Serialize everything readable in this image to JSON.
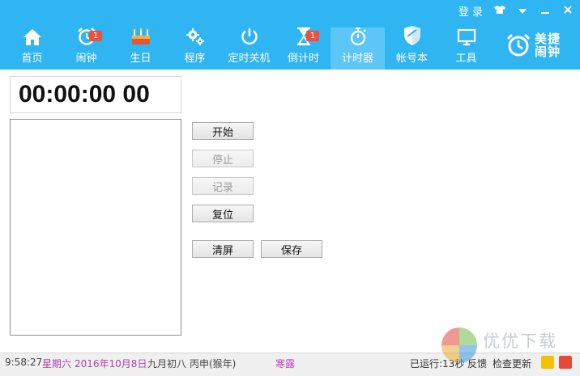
{
  "window": {
    "login_label": "登 录",
    "controls": {
      "skin_icon": "shirt-icon",
      "menu_icon": "chevron-down-icon",
      "minimize_icon": "minimize-icon",
      "close_icon": "close-icon"
    }
  },
  "nav": {
    "items": [
      {
        "label": "首页",
        "icon": "home-icon"
      },
      {
        "label": "闹钟",
        "icon": "alarm-clock-icon",
        "badge": "1"
      },
      {
        "label": "生日",
        "icon": "birthday-cake-icon"
      },
      {
        "label": "程序",
        "icon": "gear-icon"
      },
      {
        "label": "定时关机",
        "icon": "power-icon"
      },
      {
        "label": "倒计时",
        "icon": "hourglass-icon",
        "badge": "1"
      },
      {
        "label": "计时器",
        "icon": "stopwatch-icon",
        "active": true
      },
      {
        "label": "帐号本",
        "icon": "shield-icon"
      },
      {
        "label": "工具",
        "icon": "monitor-icon"
      }
    ],
    "brand_line1": "美捷",
    "brand_line2": "闹钟"
  },
  "timer": {
    "display": "00:00:00 00"
  },
  "buttons": {
    "start": "开始",
    "stop": "停止",
    "record": "记录",
    "reset": "复位",
    "clear": "清屏",
    "save": "保存"
  },
  "status": {
    "time": "9:58:27",
    "weekday": "星期六",
    "date": "2016年10月8日",
    "lunar": "九月初八",
    "ganzhi": "丙申(猴年)",
    "solar_term": "寒露",
    "running": "已运行:13秒",
    "feedback": "反馈",
    "update": "检查更新"
  },
  "watermark": {
    "text": "优优下载"
  },
  "colors": {
    "header": "#2fb5f2",
    "active_tab": "#5cc6f6",
    "badge": "#f0503c",
    "date_purple": "#b040b0"
  }
}
